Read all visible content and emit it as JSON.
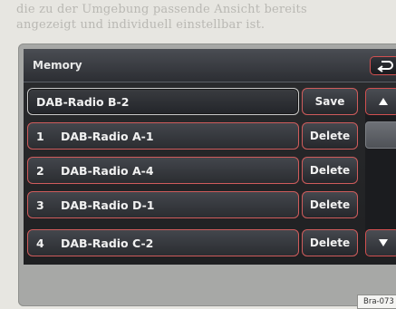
{
  "manual_text": {
    "line1": "die zu der Umgebung passende Ansicht bereits",
    "line2": "angezeigt und individuell einstellbar ist."
  },
  "header": {
    "title": "Memory",
    "back_icon": "return-arrow-icon"
  },
  "selected_entry": {
    "label": "DAB-Radio B-2",
    "action": "Save"
  },
  "entries": [
    {
      "num": "1",
      "name": "DAB-Radio A-1",
      "action": "Delete"
    },
    {
      "num": "2",
      "name": "DAB-Radio A-4",
      "action": "Delete"
    },
    {
      "num": "3",
      "name": "DAB-Radio D-1",
      "action": "Delete"
    },
    {
      "num": "4",
      "name": "DAB-Radio C-2",
      "action": "Delete"
    }
  ],
  "scrollbar": {
    "up_icon": "triangle-up-icon",
    "down_icon": "triangle-down-icon"
  },
  "reference_label": "Bra-073",
  "colors": {
    "accent_border": "#cf5c5c",
    "display_bg": "#1f2022",
    "text": "#f1f1f1"
  }
}
